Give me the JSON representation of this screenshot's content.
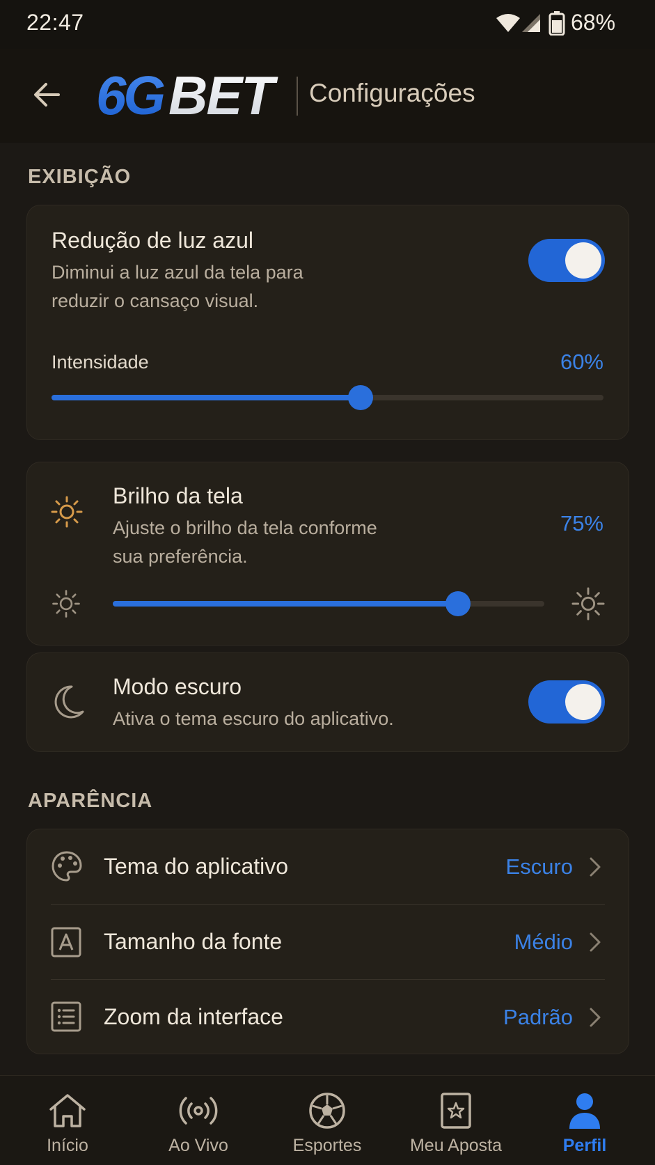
{
  "status_bar": {
    "time": "22:47",
    "battery": "68%"
  },
  "header": {
    "brand_prefix": "6G",
    "brand_suffix": "BET",
    "title": "Configurações"
  },
  "sections": {
    "display": "EXIBIÇÃO",
    "appearance": "APARÊNCIA"
  },
  "blue_light": {
    "title": "Redução de luz azul",
    "desc_line1": "Diminui a luz azul da tela para",
    "desc_line2": "reduzir o cansaço visual.",
    "enabled": true,
    "intensity_label": "Intensidade",
    "intensity_value": "60%",
    "intensity": 0.56
  },
  "brightness": {
    "title": "Brilho da tela",
    "desc_line1": "Ajuste o brilho da tela conforme",
    "desc_line2": "sua preferência.",
    "value": "75%",
    "level": 0.8
  },
  "dark_mode": {
    "title": "Modo escuro",
    "desc": "Ativa o tema escuro do aplicativo.",
    "enabled": true
  },
  "appearance_rows": [
    {
      "label": "Tema do aplicativo",
      "value": "Escuro",
      "icon": "palette-icon"
    },
    {
      "label": "Tamanho da fonte",
      "value": "Médio",
      "icon": "font-size-icon"
    },
    {
      "label": "Zoom da interface",
      "value": "Padrão",
      "icon": "zoom-list-icon"
    }
  ],
  "bottom_nav": [
    {
      "label": "Início",
      "icon": "home-icon"
    },
    {
      "label": "Ao Vivo",
      "icon": "live-broadcast-icon"
    },
    {
      "label": "Esportes",
      "icon": "soccer-ball-icon"
    },
    {
      "label": "Meu Aposta",
      "icon": "bet-slip-icon"
    },
    {
      "label": "Perfil",
      "icon": "profile-icon",
      "active": true
    }
  ],
  "colors": {
    "accent": "#2a6fdc",
    "background": "#1c1915",
    "card": "#242019",
    "sun_icon": "#d69a4a"
  }
}
